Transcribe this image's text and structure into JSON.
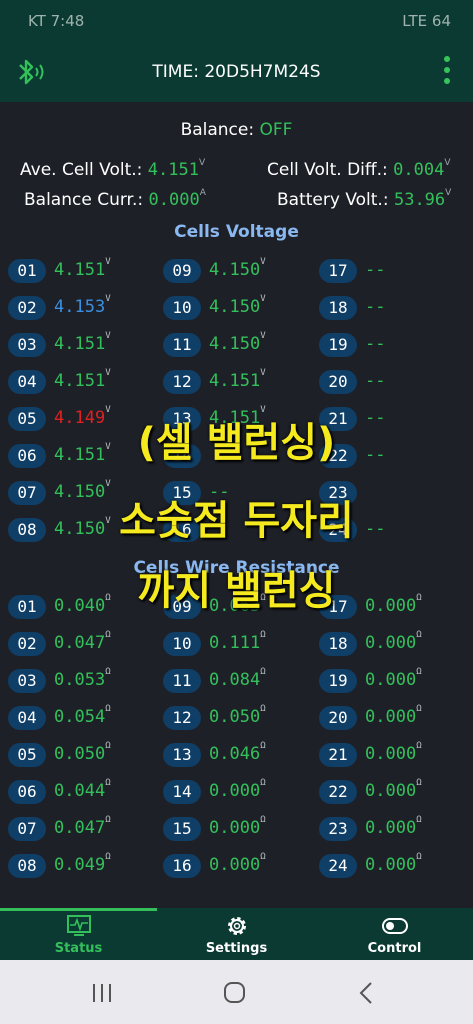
{
  "status_bar": {
    "left": "KT 7:48",
    "right": "LTE 64"
  },
  "app_bar": {
    "time": "TIME: 20D5H7M24S",
    "bt_icon": "bluetooth-icon",
    "menu_icon": "more-vertical-icon"
  },
  "balance": {
    "label": "Balance:",
    "value": "OFF"
  },
  "stats": {
    "ave_label": "Ave. Cell Volt.:",
    "ave_value": "4.151",
    "ave_unit": "V",
    "diff_label": "Cell Volt. Diff.:",
    "diff_value": "0.004",
    "diff_unit": "V",
    "curr_label": "Balance Curr.:",
    "curr_value": "0.000",
    "curr_unit": "A",
    "batt_label": "Battery Volt.:",
    "batt_value": "53.96",
    "batt_unit": "V"
  },
  "voltage": {
    "title": "Cells Voltage",
    "unit": "V",
    "cells": [
      {
        "num": "01",
        "val": "4.151",
        "color": "green"
      },
      {
        "num": "09",
        "val": "4.150",
        "color": "green"
      },
      {
        "num": "17",
        "val": "--",
        "color": "green"
      },
      {
        "num": "02",
        "val": "4.153",
        "color": "blue"
      },
      {
        "num": "10",
        "val": "4.150",
        "color": "green"
      },
      {
        "num": "18",
        "val": "--",
        "color": "green"
      },
      {
        "num": "03",
        "val": "4.151",
        "color": "green"
      },
      {
        "num": "11",
        "val": "4.150",
        "color": "green"
      },
      {
        "num": "19",
        "val": "--",
        "color": "green"
      },
      {
        "num": "04",
        "val": "4.151",
        "color": "green"
      },
      {
        "num": "12",
        "val": "4.151",
        "color": "green"
      },
      {
        "num": "20",
        "val": "--",
        "color": "green"
      },
      {
        "num": "05",
        "val": "4.149",
        "color": "red"
      },
      {
        "num": "13",
        "val": "4.151",
        "color": "green"
      },
      {
        "num": "21",
        "val": "--",
        "color": "green"
      },
      {
        "num": "06",
        "val": "4.151",
        "color": "green"
      },
      {
        "num": "14",
        "val": "",
        "color": "green"
      },
      {
        "num": "22",
        "val": "--",
        "color": "green"
      },
      {
        "num": "07",
        "val": "4.150",
        "color": "green"
      },
      {
        "num": "15",
        "val": "--",
        "color": "green"
      },
      {
        "num": "23",
        "val": "",
        "color": "green"
      },
      {
        "num": "08",
        "val": "4.150",
        "color": "green"
      },
      {
        "num": "16",
        "val": "",
        "color": "green"
      },
      {
        "num": "24",
        "val": "--",
        "color": "green"
      }
    ]
  },
  "resistance": {
    "title": "Cells Wire Resistance",
    "unit": "Ω",
    "cells": [
      {
        "num": "01",
        "val": "0.040"
      },
      {
        "num": "09",
        "val": "0.063"
      },
      {
        "num": "17",
        "val": "0.000"
      },
      {
        "num": "02",
        "val": "0.047"
      },
      {
        "num": "10",
        "val": "0.111"
      },
      {
        "num": "18",
        "val": "0.000"
      },
      {
        "num": "03",
        "val": "0.053"
      },
      {
        "num": "11",
        "val": "0.084"
      },
      {
        "num": "19",
        "val": "0.000"
      },
      {
        "num": "04",
        "val": "0.054"
      },
      {
        "num": "12",
        "val": "0.050"
      },
      {
        "num": "20",
        "val": "0.000"
      },
      {
        "num": "05",
        "val": "0.050"
      },
      {
        "num": "13",
        "val": "0.046"
      },
      {
        "num": "21",
        "val": "0.000"
      },
      {
        "num": "06",
        "val": "0.044"
      },
      {
        "num": "14",
        "val": "0.000"
      },
      {
        "num": "22",
        "val": "0.000"
      },
      {
        "num": "07",
        "val": "0.047"
      },
      {
        "num": "15",
        "val": "0.000"
      },
      {
        "num": "23",
        "val": "0.000"
      },
      {
        "num": "08",
        "val": "0.049"
      },
      {
        "num": "16",
        "val": "0.000"
      },
      {
        "num": "24",
        "val": "0.000"
      }
    ]
  },
  "overlay": {
    "line1": "(셀 밸런싱)",
    "line2": "소숫점 두자리",
    "line3": "까지 밸런싱"
  },
  "nav": {
    "status": "Status",
    "settings": "Settings",
    "control": "Control"
  },
  "colors": {
    "accent": "#33c05a",
    "appbar": "#0b3a33",
    "badge": "#0f3e66",
    "section": "#8ab8f0",
    "overlay": "#f4ea1e"
  }
}
